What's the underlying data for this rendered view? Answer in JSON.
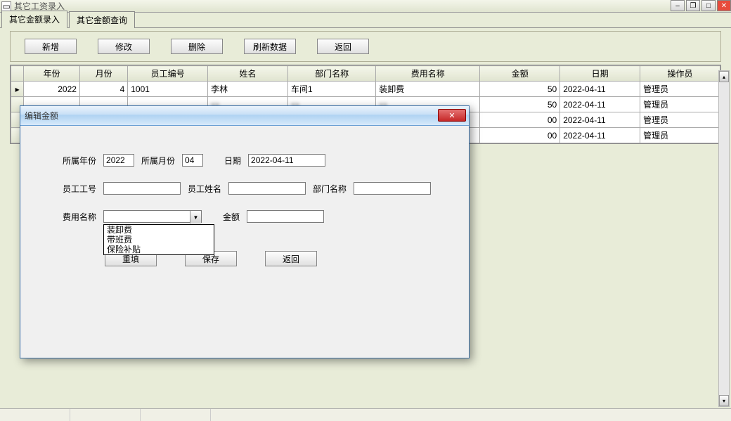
{
  "window": {
    "title": "其它工资录入",
    "minimize": "–",
    "intermediate": "❐",
    "maximize": "□",
    "close": "✕"
  },
  "tabs": [
    {
      "label": "其它金额录入",
      "active": true
    },
    {
      "label": "其它金额查询",
      "active": false
    }
  ],
  "toolbar": {
    "add": "新增",
    "edit": "修改",
    "delete": "删除",
    "refresh": "刷新数据",
    "back": "返回"
  },
  "table": {
    "columns": [
      "年份",
      "月份",
      "员工编号",
      "姓名",
      "部门名称",
      "费用名称",
      "金额",
      "日期",
      "操作员"
    ],
    "rows": [
      {
        "year": "2022",
        "month": "4",
        "empno": "1001",
        "name": "李林",
        "dept": "车间1",
        "fee": "装卸费",
        "amount": "50",
        "date": "2022-04-11",
        "operator": "管理员",
        "blur": false
      },
      {
        "year": "",
        "month": "",
        "empno": "",
        "name": "xx",
        "dept": "xx",
        "fee": "xx",
        "amount": "50",
        "date": "2022-04-11",
        "operator": "管理员",
        "blur": true
      },
      {
        "year": "",
        "month": "",
        "empno": "",
        "name": "xx",
        "dept": "xx",
        "fee": "xx",
        "amount": "00",
        "date": "2022-04-11",
        "operator": "管理员",
        "blur": true
      },
      {
        "year": "",
        "month": "",
        "empno": "",
        "name": "xx",
        "dept": "xx",
        "fee": "xx",
        "amount": "00",
        "date": "2022-04-11",
        "operator": "管理员",
        "blur": true
      }
    ]
  },
  "dialog": {
    "title": "编辑金额",
    "labels": {
      "year": "所属年份",
      "month": "所属月份",
      "date": "日期",
      "empno": "员工工号",
      "empname": "员工姓名",
      "dept": "部门名称",
      "feename": "费用名称",
      "amount": "金额"
    },
    "values": {
      "year": "2022",
      "month": "04",
      "date": "2022-04-11",
      "empno": "",
      "empname": "",
      "dept": "",
      "feename": "",
      "amount": ""
    },
    "fee_options": [
      "装卸费",
      "带班费",
      "保险补贴"
    ],
    "buttons": {
      "reset": "重填",
      "save": "保存",
      "back": "返回"
    }
  }
}
